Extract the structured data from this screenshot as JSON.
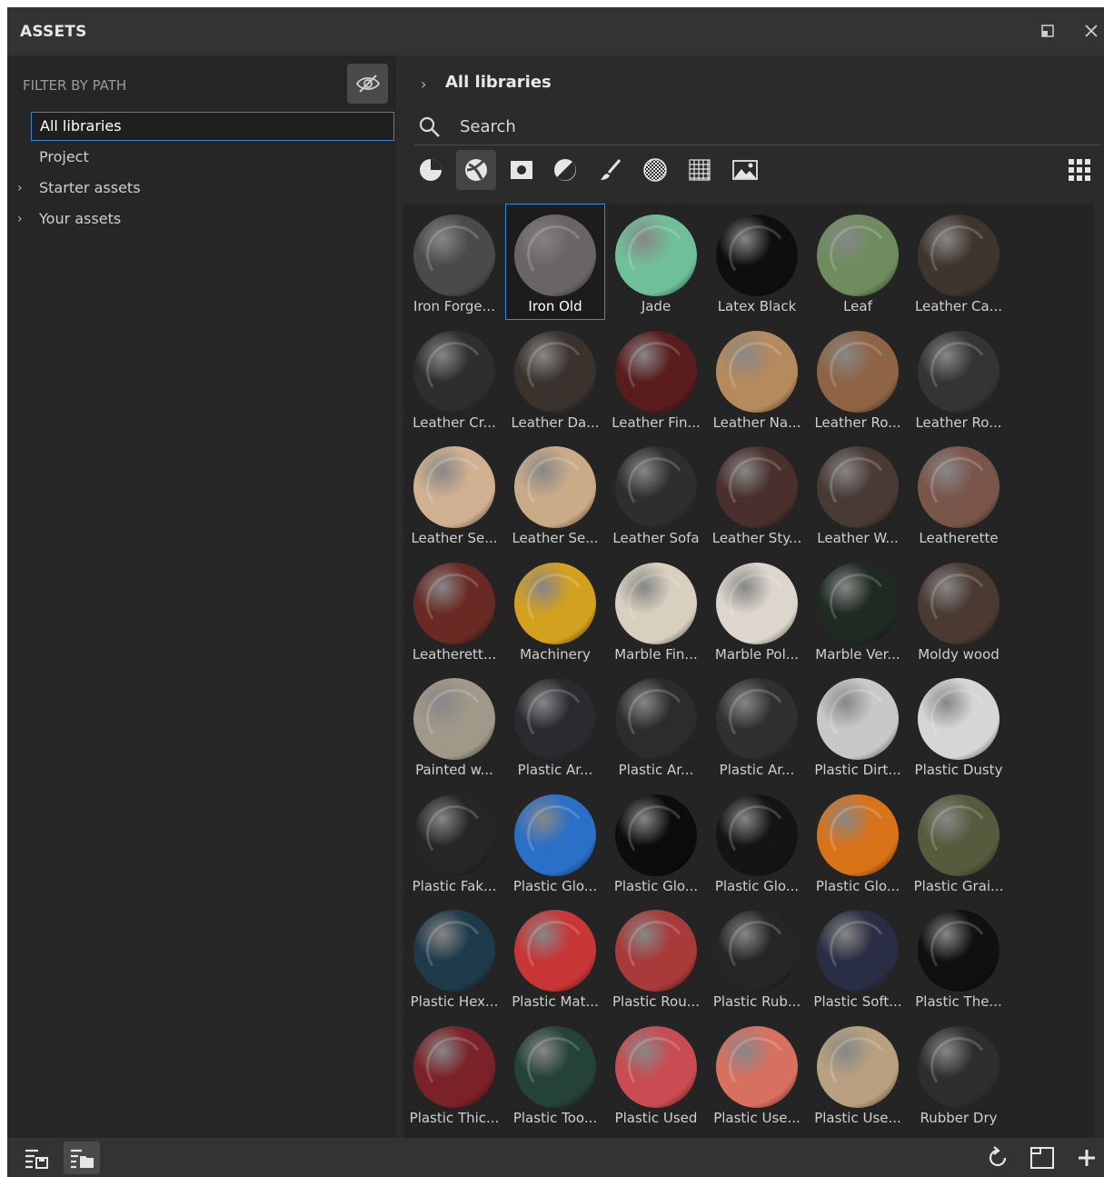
{
  "panel": {
    "title": "ASSETS"
  },
  "left": {
    "filter_label": "FILTER BY PATH",
    "tree": [
      {
        "label": "All libraries",
        "selected": true,
        "expandable": false
      },
      {
        "label": "Project",
        "selected": false,
        "expandable": false
      },
      {
        "label": "Starter assets",
        "selected": false,
        "expandable": true
      },
      {
        "label": "Your assets",
        "selected": false,
        "expandable": true
      }
    ]
  },
  "right": {
    "breadcrumb": "All libraries",
    "search_placeholder": "Search",
    "filter_icons": [
      "sphere-icon",
      "material-icon",
      "square-mask-icon",
      "half-circle-icon",
      "brush-icon",
      "checker-pattern-icon",
      "grid-pattern-icon",
      "environment-icon"
    ],
    "active_filter": "material-icon",
    "view_icon": "grid-view-icon"
  },
  "assets": [
    {
      "label": "Iron Forge...",
      "color": "#4a4a4a"
    },
    {
      "label": "Iron Old",
      "color": "#6a6564",
      "selected": true
    },
    {
      "label": "Jade",
      "color": "#6fbf9a"
    },
    {
      "label": "Latex Black",
      "color": "#0e0e0e"
    },
    {
      "label": "Leaf",
      "color": "#6f8c5e"
    },
    {
      "label": "Leather Ca...",
      "color": "#3f352e"
    },
    {
      "label": "Leather Cr...",
      "color": "#2e2e2e"
    },
    {
      "label": "Leather Da...",
      "color": "#3a322d"
    },
    {
      "label": "Leather Fin...",
      "color": "#5a1c1c"
    },
    {
      "label": "Leather Na...",
      "color": "#b58a5c"
    },
    {
      "label": "Leather Ro...",
      "color": "#8e6444"
    },
    {
      "label": "Leather Ro...",
      "color": "#343434"
    },
    {
      "label": "Leather Se...",
      "color": "#cfb090"
    },
    {
      "label": "Leather Se...",
      "color": "#c9ab88"
    },
    {
      "label": "Leather Sofa",
      "color": "#2e2e2e"
    },
    {
      "label": "Leather Sty...",
      "color": "#4a302c"
    },
    {
      "label": "Leather W...",
      "color": "#4a3a36"
    },
    {
      "label": "Leatherette",
      "color": "#7a564a"
    },
    {
      "label": "Leatherett...",
      "color": "#6a2a24"
    },
    {
      "label": "Machinery",
      "color": "#d4a020"
    },
    {
      "label": "Marble Fin...",
      "color": "#d8cfbf"
    },
    {
      "label": "Marble Pol...",
      "color": "#dcd6cc"
    },
    {
      "label": "Marble Ver...",
      "color": "#1e2a22"
    },
    {
      "label": "Moldy wood",
      "color": "#4a3a32"
    },
    {
      "label": "Painted w...",
      "color": "#a09888"
    },
    {
      "label": "Plastic Ar...",
      "color": "#2a2a30"
    },
    {
      "label": "Plastic Ar...",
      "color": "#2c2c2c"
    },
    {
      "label": "Plastic Ar...",
      "color": "#303030"
    },
    {
      "label": "Plastic Dirt...",
      "color": "#c8c8c8"
    },
    {
      "label": "Plastic Dusty",
      "color": "#d6d6d6"
    },
    {
      "label": "Plastic Fak...",
      "color": "#262626"
    },
    {
      "label": "Plastic Glo...",
      "color": "#2a6fc8"
    },
    {
      "label": "Plastic Glo...",
      "color": "#0c0c0c"
    },
    {
      "label": "Plastic Glo...",
      "color": "#141414"
    },
    {
      "label": "Plastic Glo...",
      "color": "#d9731a"
    },
    {
      "label": "Plastic Grai...",
      "color": "#575a3c"
    },
    {
      "label": "Plastic Hex...",
      "color": "#1f3a4a"
    },
    {
      "label": "Plastic Mat...",
      "color": "#c83636"
    },
    {
      "label": "Plastic Rou...",
      "color": "#a83a3a"
    },
    {
      "label": "Plastic Rub...",
      "color": "#262626"
    },
    {
      "label": "Plastic Soft...",
      "color": "#2a2e44"
    },
    {
      "label": "Plastic The...",
      "color": "#101010"
    },
    {
      "label": "Plastic Thic...",
      "color": "#7a2228"
    },
    {
      "label": "Plastic Too...",
      "color": "#244236"
    },
    {
      "label": "Plastic Used",
      "color": "#c84c52"
    },
    {
      "label": "Plastic Use...",
      "color": "#d87060"
    },
    {
      "label": "Plastic Use...",
      "color": "#b8a080"
    },
    {
      "label": "Rubber Dry",
      "color": "#2e2e2e"
    }
  ],
  "bottom": {
    "left_icons": [
      "list-save-icon",
      "list-folder-icon"
    ],
    "right_icons": [
      "refresh-icon",
      "new-window-icon",
      "add-icon"
    ]
  }
}
